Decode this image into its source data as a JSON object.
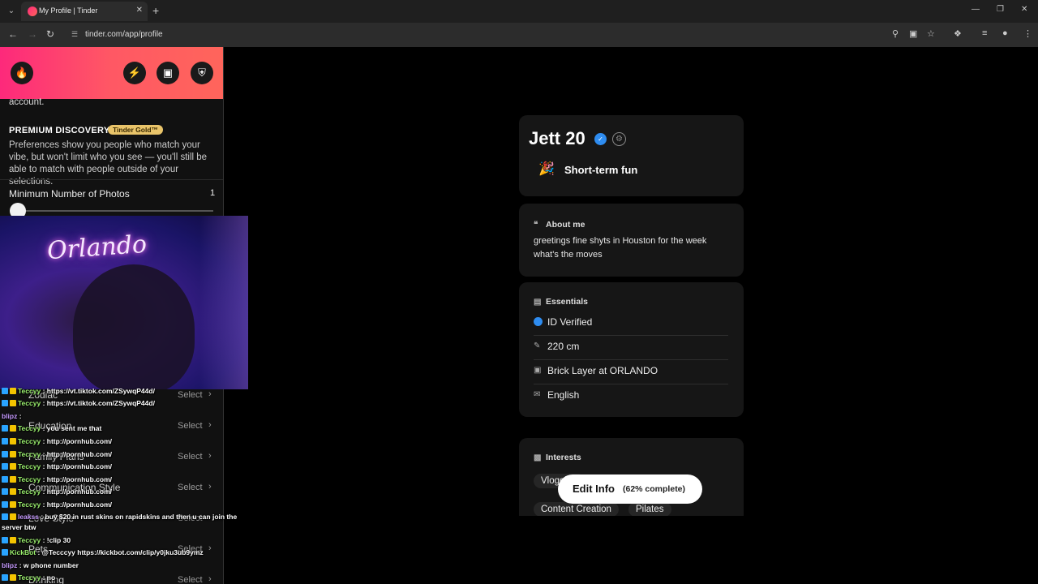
{
  "browser": {
    "tab_title": "My Profile | Tinder",
    "url": "tinder.com/app/profile"
  },
  "left": {
    "account_tail": "account.",
    "premium_title": "PREMIUM DISCOVERY",
    "gold_badge": "Tinder Gold™",
    "premium_desc": "Preferences show you people who match your vibe, but won't limit who you see — you'll still be able to match with people outside of your selections.",
    "min_photos_label": "Minimum Number of Photos",
    "min_photos_value": "1",
    "webcam_sign": "Orlando",
    "settings": [
      {
        "label": "Zodiac",
        "select": "Select"
      },
      {
        "label": "Education",
        "select": "Select"
      },
      {
        "label": "Family Plans",
        "select": "Select"
      },
      {
        "label": "Communication Style",
        "select": "Select"
      },
      {
        "label": "Love Style",
        "select": "Select"
      },
      {
        "label": "Pets",
        "select": "Select"
      },
      {
        "label": "Drinking",
        "select": "Select"
      }
    ],
    "chat": [
      {
        "user": "Teccyy",
        "msg": " : https://vt.tiktok.com/ZSywqP44d/"
      },
      {
        "user": "Teccyy",
        "msg": " : https://vt.tiktok.com/ZSywqP44d/"
      },
      {
        "user": "blipz",
        "msg": " : "
      },
      {
        "user": "Teccyy",
        "msg": " : you sent me that"
      },
      {
        "user": "Teccyy",
        "msg": " : http://pornhub.com/"
      },
      {
        "user": "Teccyy",
        "msg": " : http://pornhub.com/"
      },
      {
        "user": "Teccyy",
        "msg": " : http://pornhub.com/"
      },
      {
        "user": "Teccyy",
        "msg": " : http://pornhub.com/"
      },
      {
        "user": "Teccyy",
        "msg": " : http://pornhub.com/"
      },
      {
        "user": "Teccyy",
        "msg": " : http://pornhub.com/"
      },
      {
        "user": "leakss",
        "msg": " : buy $20 in rust skins on rapidskins and then u can join the"
      },
      {
        "user": "",
        "msg": "server btw"
      },
      {
        "user": "Teccyy",
        "msg": " : !clip 30"
      },
      {
        "user": "KickBot",
        "msg": " : @Tecccyy https://kickbot.com/clip/y0jku3ub9ymz"
      },
      {
        "user": "blipz",
        "msg": " : w phone number"
      },
      {
        "user": "Teccyy",
        "msg": " : no"
      }
    ]
  },
  "profile": {
    "name_age": "Jett 20",
    "relationship_goal": "Short-term fun",
    "about_title": "About me",
    "about_text": "greetings fine shyts in Houston for the week what's the moves",
    "essentials_title": "Essentials",
    "essentials": [
      "ID Verified",
      "220 cm",
      "Brick Layer at ORLANDO",
      "English"
    ],
    "interests_title": "Interests",
    "interests": [
      "Vlogging",
      "Content Creation",
      "Pilates"
    ],
    "edit_label": "Edit Info",
    "edit_pct": "(62% complete)"
  }
}
